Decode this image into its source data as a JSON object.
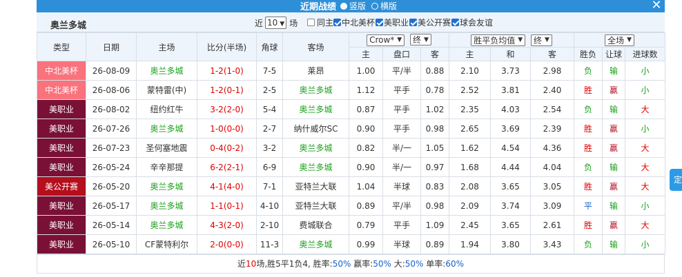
{
  "header": {
    "title": "近期战绩",
    "view_options": [
      {
        "label": "竖版",
        "selected": true
      },
      {
        "label": "横版",
        "selected": false
      }
    ],
    "close_icon": "close-icon"
  },
  "filters": {
    "team_name": "奥兰多城",
    "recent_prefix": "近",
    "recent_count": "10",
    "recent_suffix": "场",
    "same_host_label": "同主",
    "league_checks": [
      {
        "label": "中北美杯",
        "checked": true
      },
      {
        "label": "美职业",
        "checked": true
      },
      {
        "label": "美公开赛",
        "checked": true
      },
      {
        "label": "球会友谊",
        "checked": true
      }
    ]
  },
  "table": {
    "headers": {
      "type": "类型",
      "date": "日期",
      "home": "主场",
      "score": "比分(半场)",
      "corner": "角球",
      "away": "客场",
      "company_select": "Crow*",
      "handicap_stage_select": "终",
      "odds_type_select": "胜平负均值",
      "odds_stage_select": "终",
      "scope_select": "全场",
      "sub_home": "主",
      "sub_handicap": "盘口",
      "sub_away": "客",
      "sub_odds_home": "主",
      "sub_odds_draw": "和",
      "sub_odds_away": "客",
      "sub_result": "胜负",
      "sub_cover": "让球",
      "sub_goals": "进球数"
    },
    "rows": [
      {
        "type": "中北美杯",
        "type_color": "#f9727c",
        "date": "26-08-09",
        "home": "奥兰多城",
        "home_hl": true,
        "score": "1-2(1-0)",
        "corner": "7-5",
        "away": "莱昂",
        "away_hl": false,
        "h_home": "1.00",
        "h_line": "平/半",
        "h_away": "0.88",
        "o_home": "2.10",
        "o_draw": "3.73",
        "o_away": "2.98",
        "result": "负",
        "cover": "输",
        "goals": "小"
      },
      {
        "type": "中北美杯",
        "type_color": "#f9727c",
        "date": "26-08-06",
        "home": "蒙特雷(中)",
        "home_hl": false,
        "score": "1-2(0-1)",
        "corner": "2-5",
        "away": "奥兰多城",
        "away_hl": true,
        "h_home": "1.12",
        "h_line": "平手",
        "h_away": "0.78",
        "o_home": "2.52",
        "o_draw": "3.81",
        "o_away": "2.40",
        "result": "胜",
        "cover": "赢",
        "goals": "小"
      },
      {
        "type": "美职业",
        "type_color": "#7a1035",
        "date": "26-08-02",
        "home": "纽约红牛",
        "home_hl": false,
        "score": "3-2(2-0)",
        "corner": "5-4",
        "away": "奥兰多城",
        "away_hl": true,
        "h_home": "0.87",
        "h_line": "平手",
        "h_away": "1.02",
        "o_home": "2.35",
        "o_draw": "4.03",
        "o_away": "2.54",
        "result": "负",
        "cover": "输",
        "goals": "大"
      },
      {
        "type": "美职业",
        "type_color": "#7a1035",
        "date": "26-07-26",
        "home": "奥兰多城",
        "home_hl": true,
        "score": "1-0(0-0)",
        "corner": "2-7",
        "away": "纳什威尔SC",
        "away_hl": false,
        "h_home": "0.90",
        "h_line": "平手",
        "h_away": "0.98",
        "o_home": "2.65",
        "o_draw": "3.69",
        "o_away": "2.39",
        "result": "胜",
        "cover": "赢",
        "goals": "小"
      },
      {
        "type": "美职业",
        "type_color": "#7a1035",
        "date": "26-07-23",
        "home": "圣何塞地震",
        "home_hl": false,
        "score": "0-4(0-2)",
        "corner": "3-2",
        "away": "奥兰多城",
        "away_hl": true,
        "h_home": "0.82",
        "h_line": "半/一",
        "h_away": "1.05",
        "o_home": "1.62",
        "o_draw": "4.54",
        "o_away": "4.36",
        "result": "胜",
        "cover": "赢",
        "goals": "大"
      },
      {
        "type": "美职业",
        "type_color": "#7a1035",
        "date": "26-05-24",
        "home": "辛辛那提",
        "home_hl": false,
        "score": "6-2(2-1)",
        "corner": "6-9",
        "away": "奥兰多城",
        "away_hl": true,
        "h_home": "0.90",
        "h_line": "半/一",
        "h_away": "0.97",
        "o_home": "1.68",
        "o_draw": "4.44",
        "o_away": "4.04",
        "result": "负",
        "cover": "输",
        "goals": "大"
      },
      {
        "type": "美公开赛",
        "type_color": "#b50e1c",
        "date": "26-05-20",
        "home": "奥兰多城",
        "home_hl": true,
        "score": "4-1(4-0)",
        "corner": "7-1",
        "away": "亚特兰大联",
        "away_hl": false,
        "h_home": "1.04",
        "h_line": "半球",
        "h_away": "0.83",
        "o_home": "2.08",
        "o_draw": "3.65",
        "o_away": "3.05",
        "result": "胜",
        "cover": "赢",
        "goals": "大"
      },
      {
        "type": "美职业",
        "type_color": "#7a1035",
        "date": "26-05-17",
        "home": "奥兰多城",
        "home_hl": true,
        "score": "1-1(0-1)",
        "corner": "4-10",
        "away": "亚特兰大联",
        "away_hl": false,
        "h_home": "0.89",
        "h_line": "平/半",
        "h_away": "0.98",
        "o_home": "2.09",
        "o_draw": "3.74",
        "o_away": "3.09",
        "result": "平",
        "cover": "输",
        "goals": "小"
      },
      {
        "type": "美职业",
        "type_color": "#7a1035",
        "date": "26-05-14",
        "home": "奥兰多城",
        "home_hl": true,
        "score": "4-3(2-0)",
        "corner": "2-10",
        "away": "费城联合",
        "away_hl": false,
        "h_home": "0.79",
        "h_line": "平手",
        "h_away": "1.09",
        "o_home": "2.45",
        "o_draw": "3.65",
        "o_away": "2.61",
        "result": "胜",
        "cover": "赢",
        "goals": "大"
      },
      {
        "type": "美职业",
        "type_color": "#7a1035",
        "date": "26-05-10",
        "home": "CF蒙特利尔",
        "home_hl": false,
        "score": "2-0(0-0)",
        "corner": "11-3",
        "away": "奥兰多城",
        "away_hl": true,
        "h_home": "0.99",
        "h_line": "半球",
        "h_away": "0.89",
        "o_home": "1.94",
        "o_draw": "3.80",
        "o_away": "3.43",
        "result": "负",
        "cover": "输",
        "goals": "小"
      }
    ]
  },
  "summary": {
    "p1": "近",
    "games": "10",
    "p2": "场,胜5平1负4, 胜率:",
    "win_rate": "50%",
    "p3": " 赢率:",
    "cover_rate": "50%",
    "p4": " 大:",
    "over_rate": "50%",
    "p5": " 单率:",
    "odd_rate": "60%"
  },
  "side_tab": {
    "label": "定"
  },
  "colors": {
    "header_bg": "#2d8fd8",
    "highlight_team": "#19a019",
    "loss_score": "#e00000",
    "win_color": "#e00000",
    "draw_color": "#1560c8",
    "loss_color": "#19a019",
    "cover_win": "#b8102a",
    "cover_loss": "#19a019"
  }
}
